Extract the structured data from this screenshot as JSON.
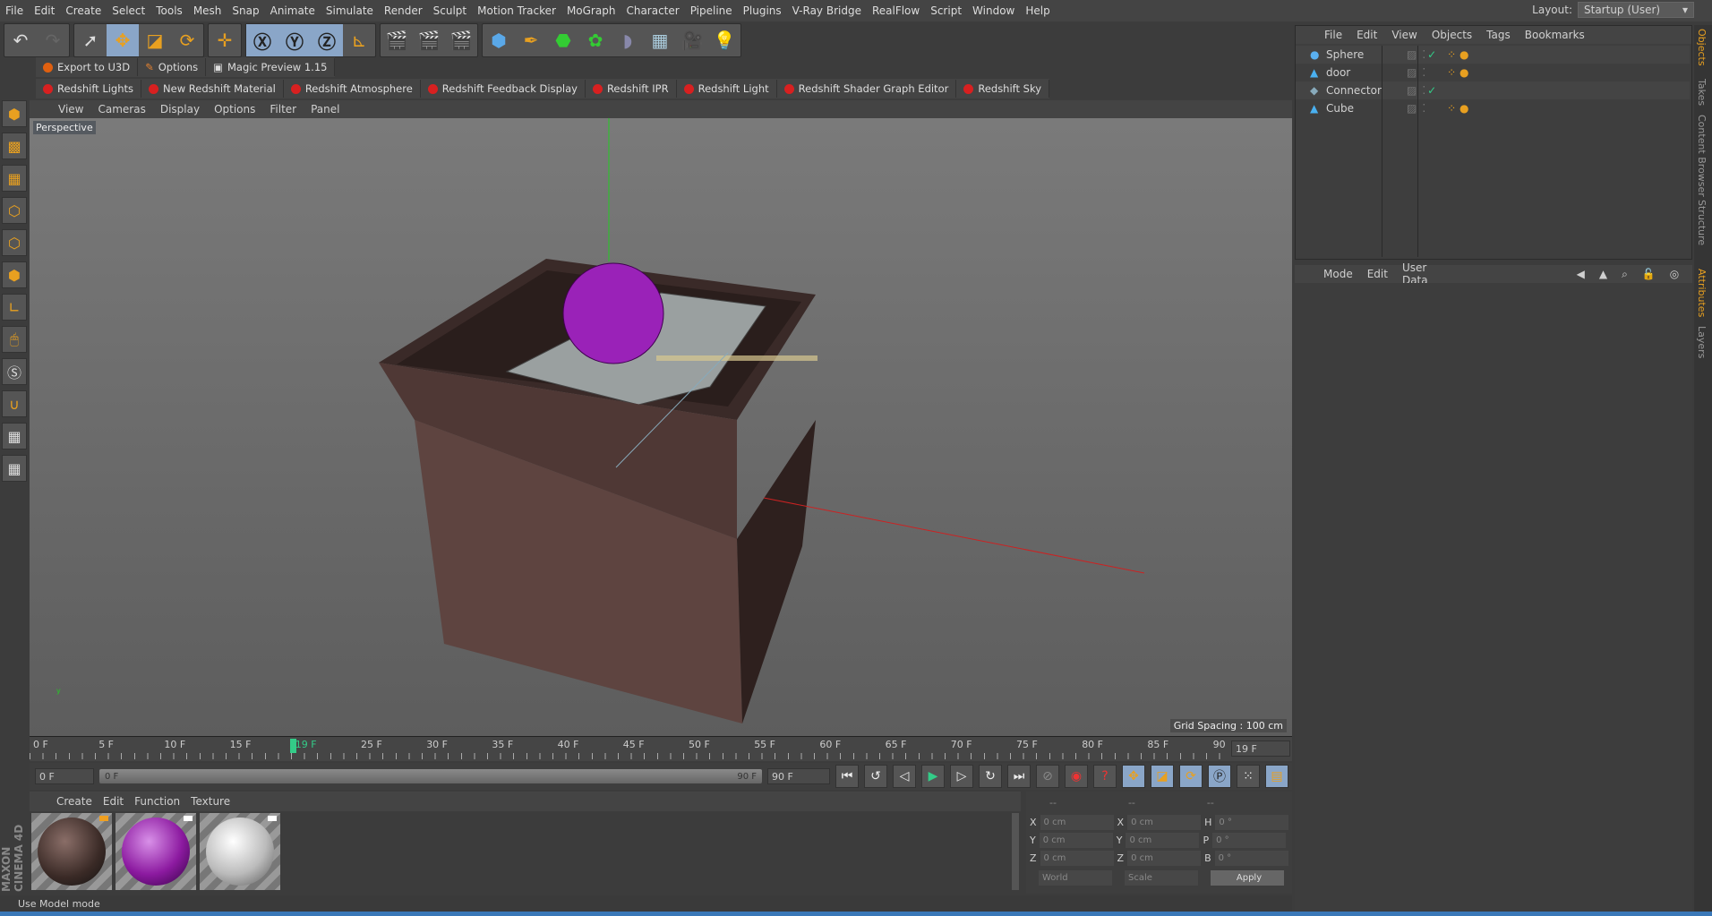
{
  "menu": [
    "File",
    "Edit",
    "Create",
    "Select",
    "Tools",
    "Mesh",
    "Snap",
    "Animate",
    "Simulate",
    "Render",
    "Sculpt",
    "Motion Tracker",
    "MoGraph",
    "Character",
    "Pipeline",
    "Plugins",
    "V-Ray Bridge",
    "RealFlow",
    "Script",
    "Window",
    "Help"
  ],
  "layout": {
    "label": "Layout:",
    "value": "Startup (User)"
  },
  "plugins1": [
    "Export to U3D",
    "Options",
    "Magic Preview 1.15"
  ],
  "plugins2": [
    "Redshift Lights",
    "New Redshift Material",
    "Redshift Atmosphere",
    "Redshift Feedback Display",
    "Redshift IPR",
    "Redshift Light",
    "Redshift Shader Graph Editor",
    "Redshift Sky"
  ],
  "viewport": {
    "menu": [
      "View",
      "Cameras",
      "Display",
      "Options",
      "Filter",
      "Panel"
    ],
    "label": "Perspective",
    "grid": "Grid Spacing : 100 cm"
  },
  "timeline": {
    "ticks": [
      "0 F",
      "5 F",
      "10 F",
      "15 F",
      "19 F",
      "25 F",
      "30 F",
      "35 F",
      "40 F",
      "45 F",
      "50 F",
      "55 F",
      "60 F",
      "65 F",
      "70 F",
      "75 F",
      "80 F",
      "85 F",
      "90"
    ],
    "current": "19 F",
    "start": "0 F",
    "range_start": "0 F",
    "range_end": "90 F",
    "end": "90 F",
    "current_frame": 19,
    "max_frame": 90
  },
  "materials": {
    "menu": [
      "Create",
      "Edit",
      "Function",
      "Texture"
    ],
    "colors": [
      "#4a3632",
      "#8c1aa0",
      "#c8c8c8"
    ]
  },
  "coords": {
    "headers": [
      "--",
      "--",
      "--"
    ],
    "rows": [
      [
        "X",
        "0 cm",
        "X",
        "0 cm",
        "H",
        "0 °"
      ],
      [
        "Y",
        "0 cm",
        "Y",
        "0 cm",
        "P",
        "0 °"
      ],
      [
        "Z",
        "0 cm",
        "Z",
        "0 cm",
        "B",
        "0 °"
      ]
    ],
    "world": "World",
    "scale": "Scale",
    "apply": "Apply"
  },
  "status": "Use Model mode",
  "objects": {
    "menu": [
      "File",
      "Edit",
      "View",
      "Objects",
      "Tags",
      "Bookmarks"
    ],
    "items": [
      {
        "name": "Sphere",
        "check": true
      },
      {
        "name": "door",
        "check": false
      },
      {
        "name": "Connector",
        "check": true
      },
      {
        "name": "Cube",
        "check": false
      }
    ]
  },
  "attributes": {
    "menu": [
      "Mode",
      "Edit",
      "User Data"
    ]
  },
  "sidetabs": [
    "Objects",
    "Takes",
    "Content Browser",
    "Structure",
    "Attributes",
    "Layers"
  ],
  "brand": "MAXON CINEMA 4D"
}
